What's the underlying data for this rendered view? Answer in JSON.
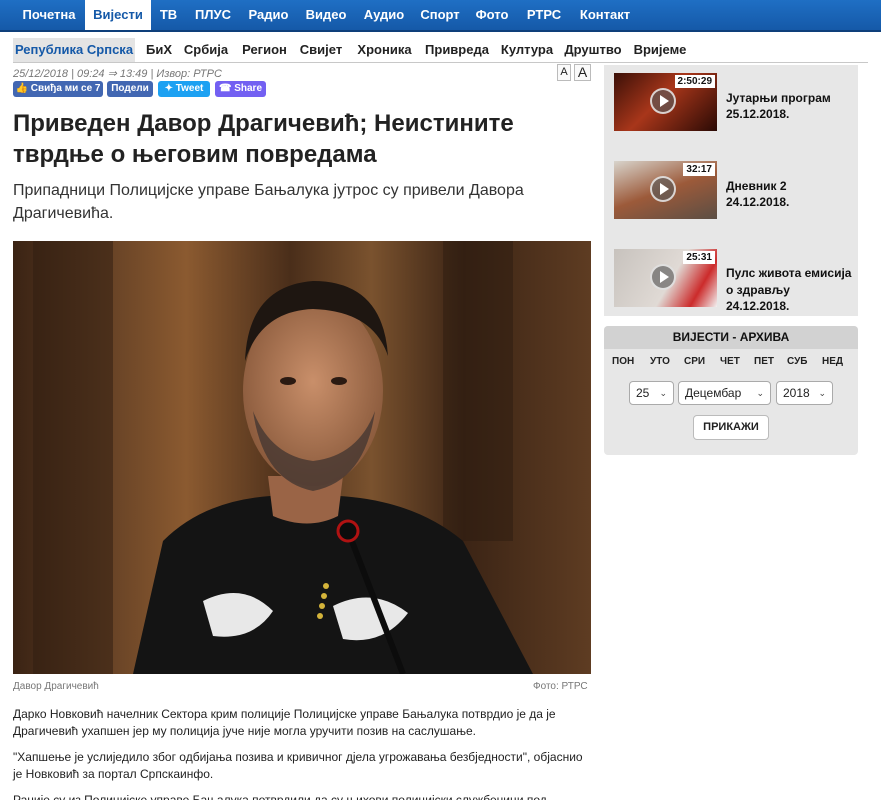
{
  "topnav": [
    "Почетна",
    "Вијести",
    "ТВ",
    "ПЛУС",
    "Радио",
    "Видео",
    "Аудио",
    "Спорт",
    "Фото",
    "РТРС",
    "Контакт"
  ],
  "subnav": [
    "Република Српска",
    "БиХ",
    "Србија",
    "Регион",
    "Свијет",
    "Хроника",
    "Привреда",
    "Култура",
    "Друштво",
    "Вријеме"
  ],
  "article": {
    "meta": "25/12/2018 | 09:24 ⇒ 13:49 | Извор: РТРС",
    "title": "Приведен Давор Драгичевић; Неистините тврдње о његовим повредама",
    "lead": "Припадници Полицијске управе Бањалука јутрос су привели Давора Драгичевића.",
    "photo_caption": "Давор Драгичевић",
    "photo_credit": "Фото: РТРС",
    "paragraphs": [
      "Дарко Новковић начелник Сектора крим полиције Полицијске управе Бањалука потврдио је да је Драгичевић ухапшен јер му полиција јуче није могла уручити позив на саслушање.",
      "\"Хапшење је услиједило због одбијања позива и кривичног дјела угрожавања безбједности\", објаснио је Новковић за портал Српскаинфо.",
      "Раније су из Полицијске управе Бањалука потврдили да су њихови полицијски службеници под"
    ]
  },
  "font_size": {
    "small": "A",
    "large": "A"
  },
  "social": {
    "like": "Свиђа ми се 7",
    "share": "Подели",
    "tweet": "Tweet",
    "viber": "Share"
  },
  "videos": [
    {
      "duration": "2:50:29",
      "title": "Јутарњи програм",
      "date": "25.12.2018."
    },
    {
      "duration": "32:17",
      "title": "Дневник 2",
      "date": "24.12.2018."
    },
    {
      "duration": "25:31",
      "title": "Пулс живота емисија о здрављу",
      "date": "24.12.2018."
    }
  ],
  "archive": {
    "title": "ВИЈЕСТИ - АРХИВА",
    "days": [
      "ПОН",
      "УТО",
      "СРИ",
      "ЧЕТ",
      "ПЕТ",
      "СУБ",
      "НЕД"
    ],
    "day_value": "25",
    "month_value": "Децембар",
    "year_value": "2018",
    "button": "ПРИКАЖИ"
  },
  "colors": {
    "nav_blue": "#1559a8",
    "panel_gray": "#e7e7e7",
    "active_sub_bg": "#e4e4e4"
  }
}
